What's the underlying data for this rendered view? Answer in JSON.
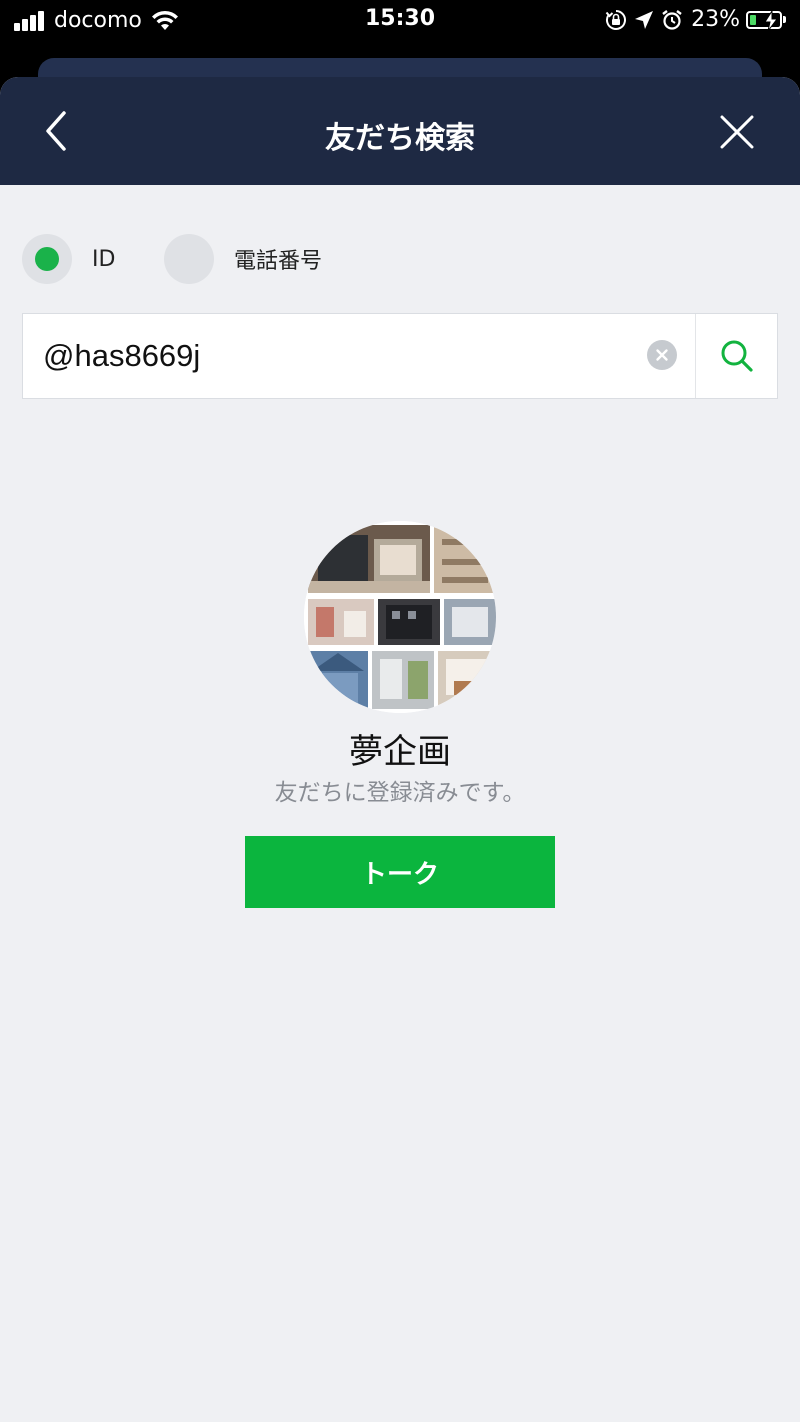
{
  "status_bar": {
    "carrier": "docomo",
    "time": "15:30",
    "battery_percent": "23%",
    "battery_level": 0.23,
    "icons": [
      "signal-bars-icon",
      "wifi-icon",
      "orientation-lock-icon",
      "location-arrow-icon",
      "alarm-icon",
      "battery-charging-icon"
    ]
  },
  "header": {
    "title": "友だち検索",
    "back_icon": "chevron-left-icon",
    "close_icon": "close-icon"
  },
  "search_type": {
    "options": [
      {
        "label": "ID",
        "selected": true
      },
      {
        "label": "電話番号",
        "selected": false
      }
    ]
  },
  "search": {
    "value": "@has8669j",
    "clear_icon": "clear-icon",
    "search_icon": "search-icon"
  },
  "result": {
    "name": "夢企画",
    "status": "友だちに登録済みです。",
    "talk_button": "トーク"
  },
  "colors": {
    "header_bg": "#1e2943",
    "accent_green": "#0bb53e",
    "page_bg": "#eff0f3"
  }
}
